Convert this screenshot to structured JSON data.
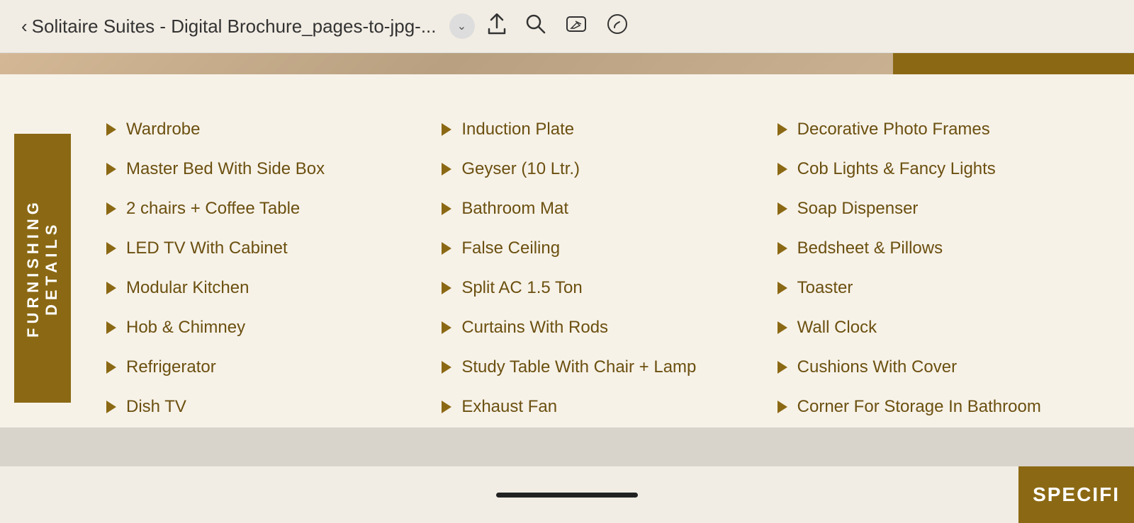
{
  "browser": {
    "back_label": "‹",
    "title": "Solitaire Suites - Digital Brochure_pages-to-jpg-...",
    "chevron": "⌄",
    "share_icon": "share",
    "search_icon": "search",
    "edit_icon": "edit",
    "annotate_icon": "annotate"
  },
  "section": {
    "vertical_label": "FURNISHING DETAILS",
    "columns": [
      {
        "items": [
          "Wardrobe",
          "Master Bed With Side Box",
          "2 chairs + Coffee Table",
          "LED TV With Cabinet",
          "Modular Kitchen",
          "Hob & Chimney",
          "Refrigerator",
          "Dish TV"
        ]
      },
      {
        "items": [
          "Induction Plate",
          "Geyser (10 Ltr.)",
          "Bathroom Mat",
          "False Ceiling",
          "Split AC 1.5 Ton",
          "Curtains With Rods",
          "Study Table With Chair + Lamp",
          "Exhaust Fan"
        ]
      },
      {
        "items": [
          "Decorative Photo Frames",
          "Cob Lights & Fancy Lights",
          "Soap Dispenser",
          "Bedsheet & Pillows",
          "Toaster",
          "Wall Clock",
          "Cushions With Cover",
          "Corner For Storage In Bathroom"
        ]
      }
    ]
  },
  "bottom": {
    "specifi_label": "SPECIFI"
  }
}
